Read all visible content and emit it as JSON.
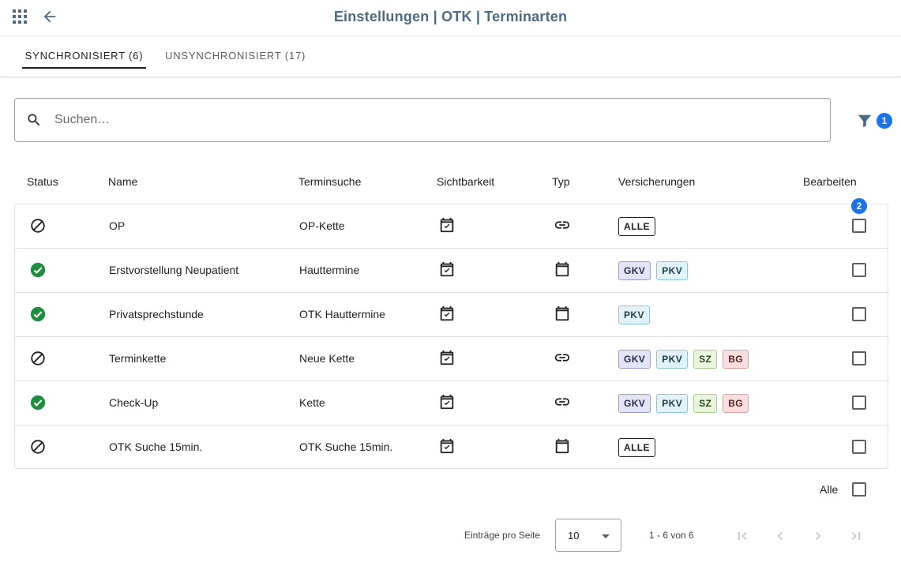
{
  "header": {
    "title": "Einstellungen | OTK | Terminarten",
    "apps_icon": "apps-grid-icon",
    "back_icon": "arrow-left-icon"
  },
  "tabs": [
    {
      "label": "SYNCHRONISIERT (6)",
      "active": true
    },
    {
      "label": "UNSYNCHRONISIERT (17)",
      "active": false
    }
  ],
  "search": {
    "placeholder": "Suchen…",
    "value": ""
  },
  "filter": {
    "icon": "filter-icon",
    "badge_count": "1"
  },
  "table": {
    "columns": [
      "Status",
      "Name",
      "Terminsuche",
      "Sichtbarkeit",
      "Typ",
      "Versicherungen",
      "Bearbeiten"
    ],
    "edit_badge": "2",
    "rows": [
      {
        "status": "inactive",
        "name": "OP",
        "terminsuche": "OP-Kette",
        "visibility": "calendar-check-icon",
        "type": "link",
        "insurances": [
          "ALLE"
        ],
        "edit_checked": false
      },
      {
        "status": "active",
        "name": "Erstvorstellung Neupatient",
        "terminsuche": "Hauttermine",
        "visibility": "calendar-check-icon",
        "type": "calendar",
        "insurances": [
          "GKV",
          "PKV"
        ],
        "edit_checked": false
      },
      {
        "status": "active",
        "name": "Privatsprechstunde",
        "terminsuche": "OTK Hauttermine",
        "visibility": "calendar-check-icon",
        "type": "calendar",
        "insurances": [
          "PKV"
        ],
        "edit_checked": false
      },
      {
        "status": "inactive",
        "name": "Terminkette",
        "terminsuche": "Neue Kette",
        "visibility": "calendar-check-icon",
        "type": "link",
        "insurances": [
          "GKV",
          "PKV",
          "SZ",
          "BG"
        ],
        "edit_checked": false
      },
      {
        "status": "active",
        "name": "Check-Up",
        "terminsuche": "Kette",
        "visibility": "calendar-check-icon",
        "type": "link",
        "insurances": [
          "GKV",
          "PKV",
          "SZ",
          "BG"
        ],
        "edit_checked": false
      },
      {
        "status": "inactive",
        "name": "OTK Suche 15min.",
        "terminsuche": "OTK Suche 15min.",
        "visibility": "calendar-check-icon",
        "type": "calendar",
        "insurances": [
          "ALLE"
        ],
        "edit_checked": false
      }
    ]
  },
  "insurance_colors": {
    "ALLE": {
      "bg": "#ffffff",
      "border": "#212121",
      "text": "#212121"
    },
    "GKV": {
      "bg": "#e4e4f7",
      "border": "#9a9ad6",
      "text": "#2a2a55"
    },
    "PKV": {
      "bg": "#e2f2f7",
      "border": "#8cc6d9",
      "text": "#1f3f4a"
    },
    "SZ": {
      "bg": "#e9f5df",
      "border": "#a7d08a",
      "text": "#2b4a1c"
    },
    "BG": {
      "bg": "#f9dede",
      "border": "#e39a9a",
      "text": "#5a1f1f"
    }
  },
  "colors": {
    "accent": "#4a6b82",
    "active_status": "#1e8e3e",
    "badge": "#1a73e8"
  },
  "select_all": {
    "label": "Alle",
    "checked": false
  },
  "pagination": {
    "per_page_label": "Einträge pro Seite",
    "per_page_value": "10",
    "range": "1 - 6 von 6"
  }
}
